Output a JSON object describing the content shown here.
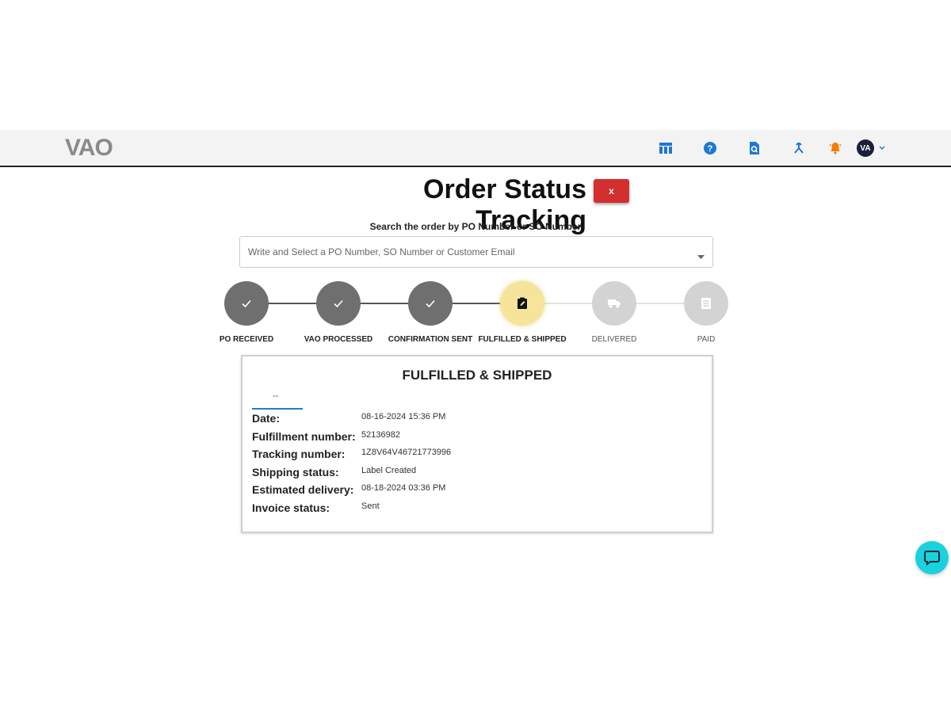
{
  "header": {
    "logo": "VAO",
    "icons": [
      "table-icon",
      "help-icon",
      "document-search-icon",
      "merge-icon",
      "bell-icon"
    ],
    "avatar_initials": "VA"
  },
  "page": {
    "title": "Order Status Tracking",
    "close_label": "x",
    "search_label": "Search the order by PO Number or SO Number",
    "search_placeholder": "Write and Select a PO Number, SO Number or Customer Email"
  },
  "steps": [
    {
      "label": "PO RECEIVED",
      "state": "completed"
    },
    {
      "label": "VAO PROCESSED",
      "state": "completed"
    },
    {
      "label": "CONFIRMATION SENT",
      "state": "completed"
    },
    {
      "label": "FULFILLED & SHIPPED",
      "state": "active"
    },
    {
      "label": "DELIVERED",
      "state": "pending"
    },
    {
      "label": "PAID",
      "state": "pending"
    }
  ],
  "details": {
    "title": "FULFILLED & SHIPPED",
    "dash": "--",
    "rows": [
      {
        "label": "Date:",
        "value": "08-16-2024 15:36 PM"
      },
      {
        "label": "Fulfillment number:",
        "value": "52136982"
      },
      {
        "label": "Tracking number:",
        "value": "1Z8V64V46721773996"
      },
      {
        "label": "Shipping status:",
        "value": "Label Created"
      },
      {
        "label": "Estimated delivery:",
        "value": "08-18-2024 03:36 PM"
      },
      {
        "label": "Invoice status:",
        "value": "Sent"
      }
    ]
  },
  "colors": {
    "completed": "#6f6f6f",
    "active": "#f5e49a",
    "pending": "#d3d3d3",
    "accent": "#1e88e5",
    "danger": "#d32f2f",
    "chat": "#19d2dd"
  }
}
